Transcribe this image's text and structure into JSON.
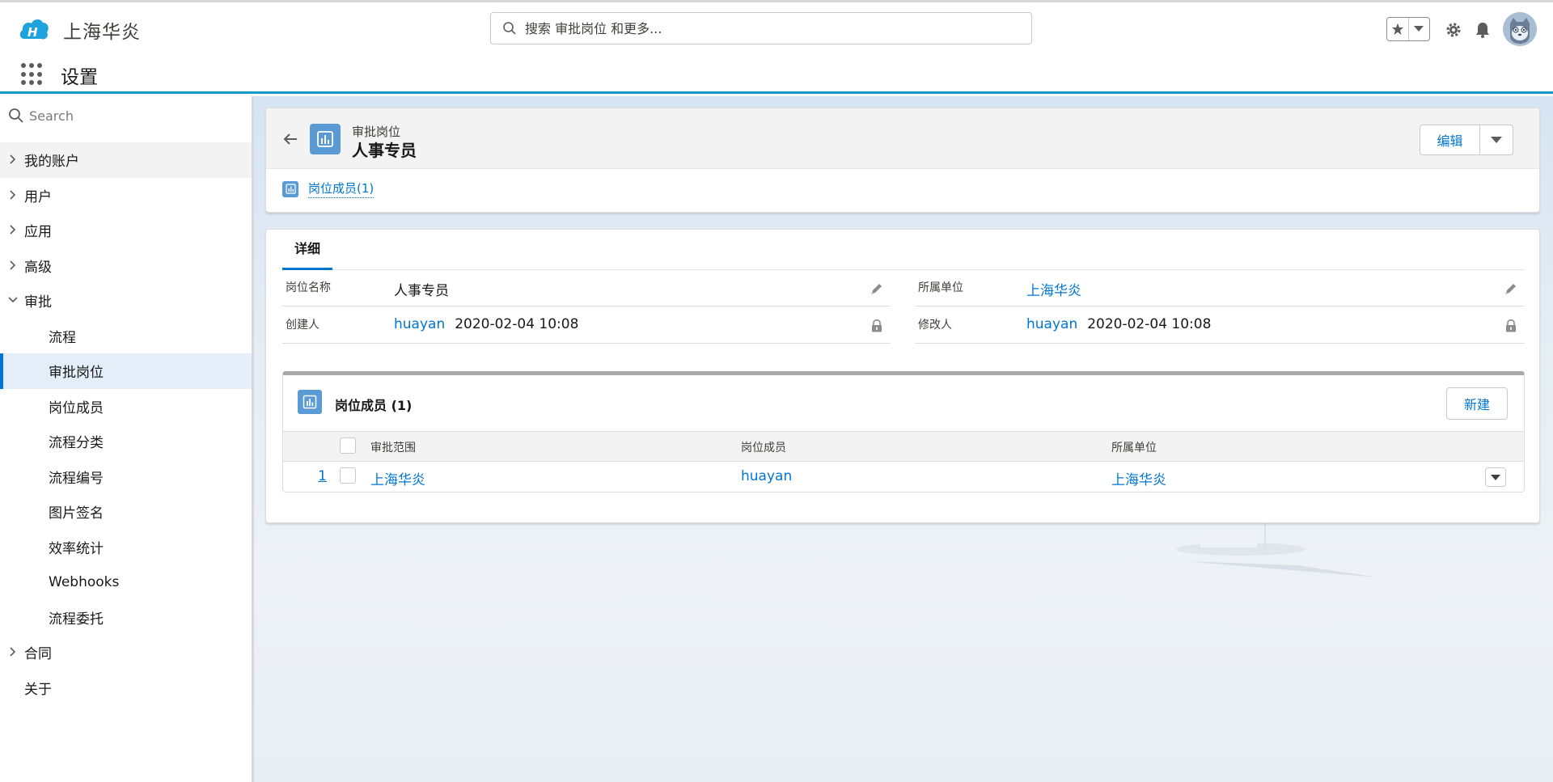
{
  "header": {
    "brand": "上海华炎",
    "search_placeholder": "搜索 审批岗位 和更多..."
  },
  "app_nav": {
    "title": "设置"
  },
  "sidebar": {
    "search_placeholder": "Search",
    "items": [
      {
        "label": "我的账户",
        "level": "top",
        "expandable": true,
        "state": "hover"
      },
      {
        "label": "用户",
        "level": "top",
        "expandable": true
      },
      {
        "label": "应用",
        "level": "top",
        "expandable": true
      },
      {
        "label": "高级",
        "level": "top",
        "expandable": true
      },
      {
        "label": "审批",
        "level": "top",
        "expandable": true,
        "expanded": true
      },
      {
        "label": "流程",
        "level": "sub"
      },
      {
        "label": "审批岗位",
        "level": "sub",
        "state": "selected"
      },
      {
        "label": "岗位成员",
        "level": "sub"
      },
      {
        "label": "流程分类",
        "level": "sub"
      },
      {
        "label": "流程编号",
        "level": "sub"
      },
      {
        "label": "图片签名",
        "level": "sub"
      },
      {
        "label": "效率统计",
        "level": "sub"
      },
      {
        "label": "Webhooks",
        "level": "sub"
      },
      {
        "label": "流程委托",
        "level": "sub"
      },
      {
        "label": "合同",
        "level": "top",
        "expandable": true
      },
      {
        "label": "关于",
        "level": "top",
        "expandable": false
      }
    ]
  },
  "record": {
    "object_type": "审批岗位",
    "name": "人事专员",
    "edit_label": "编辑",
    "related_link": "岗位成员(1)"
  },
  "details": {
    "tab_label": "详细",
    "fields": {
      "position_name": {
        "label": "岗位名称",
        "value": "人事专员"
      },
      "unit": {
        "label": "所属单位",
        "value": "上海华炎"
      },
      "created_by": {
        "label": "创建人",
        "user": "huayan",
        "time": "2020-02-04 10:08"
      },
      "modified_by": {
        "label": "修改人",
        "user": "huayan",
        "time": "2020-02-04 10:08"
      }
    }
  },
  "related_list": {
    "title": "岗位成员 (1)",
    "new_label": "新建",
    "columns": [
      "审批范围",
      "岗位成员",
      "所属单位"
    ],
    "rows": [
      {
        "num": "1",
        "scope": "上海华炎",
        "member": "huayan",
        "unit": "上海华炎"
      }
    ]
  },
  "colors": {
    "brand_blue": "#0176d3",
    "accent_bar": "#1b96c8",
    "object_icon": "#5b9bd5"
  }
}
